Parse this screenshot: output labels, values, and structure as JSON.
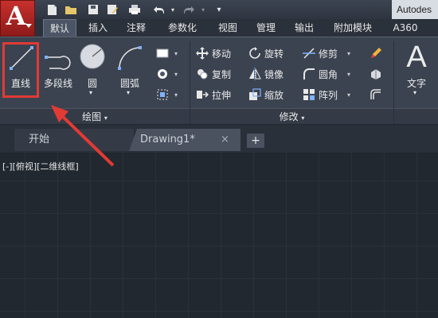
{
  "app": {
    "logo_letter": "A",
    "brand_partial": "Autodes"
  },
  "quick_access": [
    "new-icon",
    "open-icon",
    "save-icon",
    "saveas-icon",
    "print-icon",
    "undo-icon",
    "redo-icon",
    "workspace-dropdown-icon"
  ],
  "tabs": [
    {
      "label": "默认",
      "active": true
    },
    {
      "label": "插入"
    },
    {
      "label": "注释"
    },
    {
      "label": "参数化"
    },
    {
      "label": "视图"
    },
    {
      "label": "管理"
    },
    {
      "label": "输出"
    },
    {
      "label": "附加模块"
    },
    {
      "label": "A360"
    }
  ],
  "draw_panel": {
    "title": "绘图",
    "line": "直线",
    "polyline": "多段线",
    "circle": "圆",
    "arc": "圆弧"
  },
  "modify_panel": {
    "title": "修改",
    "move": "移动",
    "rotate": "旋转",
    "trim": "修剪",
    "copy": "复制",
    "mirror": "镜像",
    "fillet": "圆角",
    "stretch": "拉伸",
    "scale": "缩放",
    "array": "阵列"
  },
  "annotation_panel": {
    "text": "文字",
    "letter": "A"
  },
  "file_tabs": {
    "start": "开始",
    "drawing": "Drawing1*",
    "close": "×",
    "add": "+"
  },
  "viewport_label": "[-][俯视][二维线框]",
  "colors": {
    "accent_red": "#e23a35",
    "ribbon": "#3b4350",
    "canvas": "#212830"
  }
}
